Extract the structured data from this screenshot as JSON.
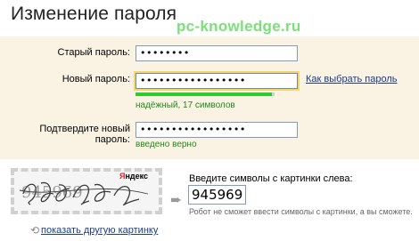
{
  "page": {
    "title": "Изменение пароля",
    "watermark": "pc-knowledge.ru"
  },
  "form": {
    "old_password": {
      "label": "Старый пароль:",
      "value": "••••••••"
    },
    "new_password": {
      "label": "Новый пароль:",
      "value": "•••••••••••••••••",
      "help_link": "Как выбрать пароль",
      "strength_percent": 98,
      "strength_text": "надёжный, 17 символов"
    },
    "confirm_password": {
      "label": "Подтвердите новый пароль:",
      "value": "•••••••••••••••••",
      "status_text": "введено верно"
    }
  },
  "captcha": {
    "image_text": "945969",
    "logo_text_red": "Я",
    "logo_text_rest": "ндекс",
    "prompt": "Введите символы с картинки слева:",
    "value": "945969",
    "note": "Робот не сможет ввести символы с картинки, а вы сможете.",
    "refresh_link": "показать другую картинку"
  },
  "colors": {
    "panel_bg": "#faf3e3",
    "strength_fill": "#2ecb2e",
    "ok_text": "#1f8a1f",
    "link": "#1a3a8a",
    "focus_glow": "#f6d66b"
  },
  "icons": {
    "arrow": "arrow-right-icon",
    "refresh": "refresh-icon"
  }
}
